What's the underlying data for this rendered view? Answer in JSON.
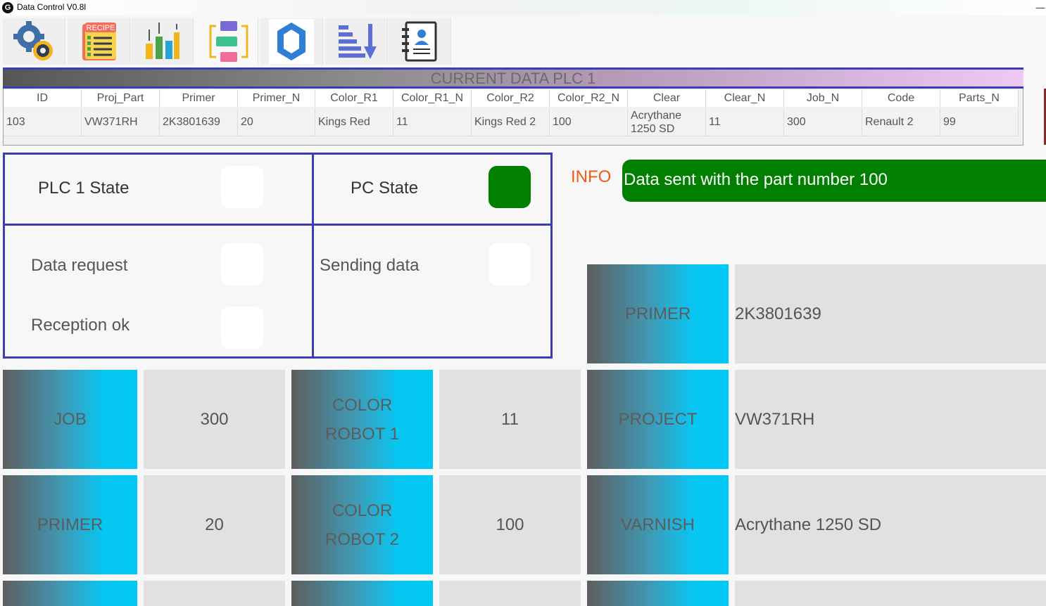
{
  "window": {
    "title": "Data Control V0.8l",
    "app_icon_letter": "G",
    "minimize_glyph": "—"
  },
  "toolbar": [
    {
      "name": "settings",
      "icon": "gears-icon"
    },
    {
      "name": "recipe",
      "icon": "recipe-icon",
      "label": "RECIPE"
    },
    {
      "name": "charts",
      "icon": "bar-chart-up-icon"
    },
    {
      "name": "data-transfer",
      "icon": "data-flow-icon"
    },
    {
      "name": "hex",
      "icon": "hexagon-icon"
    },
    {
      "name": "sort",
      "icon": "sort-down-icon"
    },
    {
      "name": "users",
      "icon": "contact-book-icon"
    }
  ],
  "current_data": {
    "title": "CURRENT DATA PLC 1",
    "columns": [
      "ID",
      "Proj_Part",
      "Primer",
      "Primer_N",
      "Color_R1",
      "Color_R1_N",
      "Color_R2",
      "Color_R2_N",
      "Clear",
      "Clear_N",
      "Job_N",
      "Code",
      "Parts_N"
    ],
    "row": [
      "103",
      "VW371RH",
      "2K3801639",
      "20",
      "Kings Red",
      "11",
      "Kings Red 2",
      "100",
      "Acrythane 1250 SD",
      "11",
      "300",
      "Renault 2",
      "99"
    ]
  },
  "states": {
    "plc_state": "PLC 1 State",
    "pc_state": "PC State",
    "data_request": "Data request",
    "sending_data": "Sending data",
    "reception_ok": "Reception ok",
    "led_on_color": "#007f00",
    "led_off_color": "#ffffff"
  },
  "info": {
    "label": "INFO",
    "message": "Data sent with the part number 100",
    "message_bg": "#007f00"
  },
  "tiles": {
    "primer_top": {
      "label": "PRIMER",
      "value": "2K3801639"
    },
    "job": {
      "label": "JOB",
      "value": "300"
    },
    "color_robot_1": {
      "label_line1": "COLOR",
      "label_line2": "ROBOT 1",
      "value": "11"
    },
    "project": {
      "label": "PROJECT",
      "value": "VW371RH"
    },
    "primer": {
      "label": "PRIMER",
      "value": "20"
    },
    "color_robot_2": {
      "label_line1": "COLOR",
      "label_line2": "ROBOT 2",
      "value": "100"
    },
    "varnish": {
      "label": "VARNISH",
      "value": "Acrythane 1250 SD"
    }
  },
  "colors": {
    "accent_border": "#3c3cb4",
    "info_orange": "#f05a1a",
    "tile_cyan": "#00c8f5"
  }
}
